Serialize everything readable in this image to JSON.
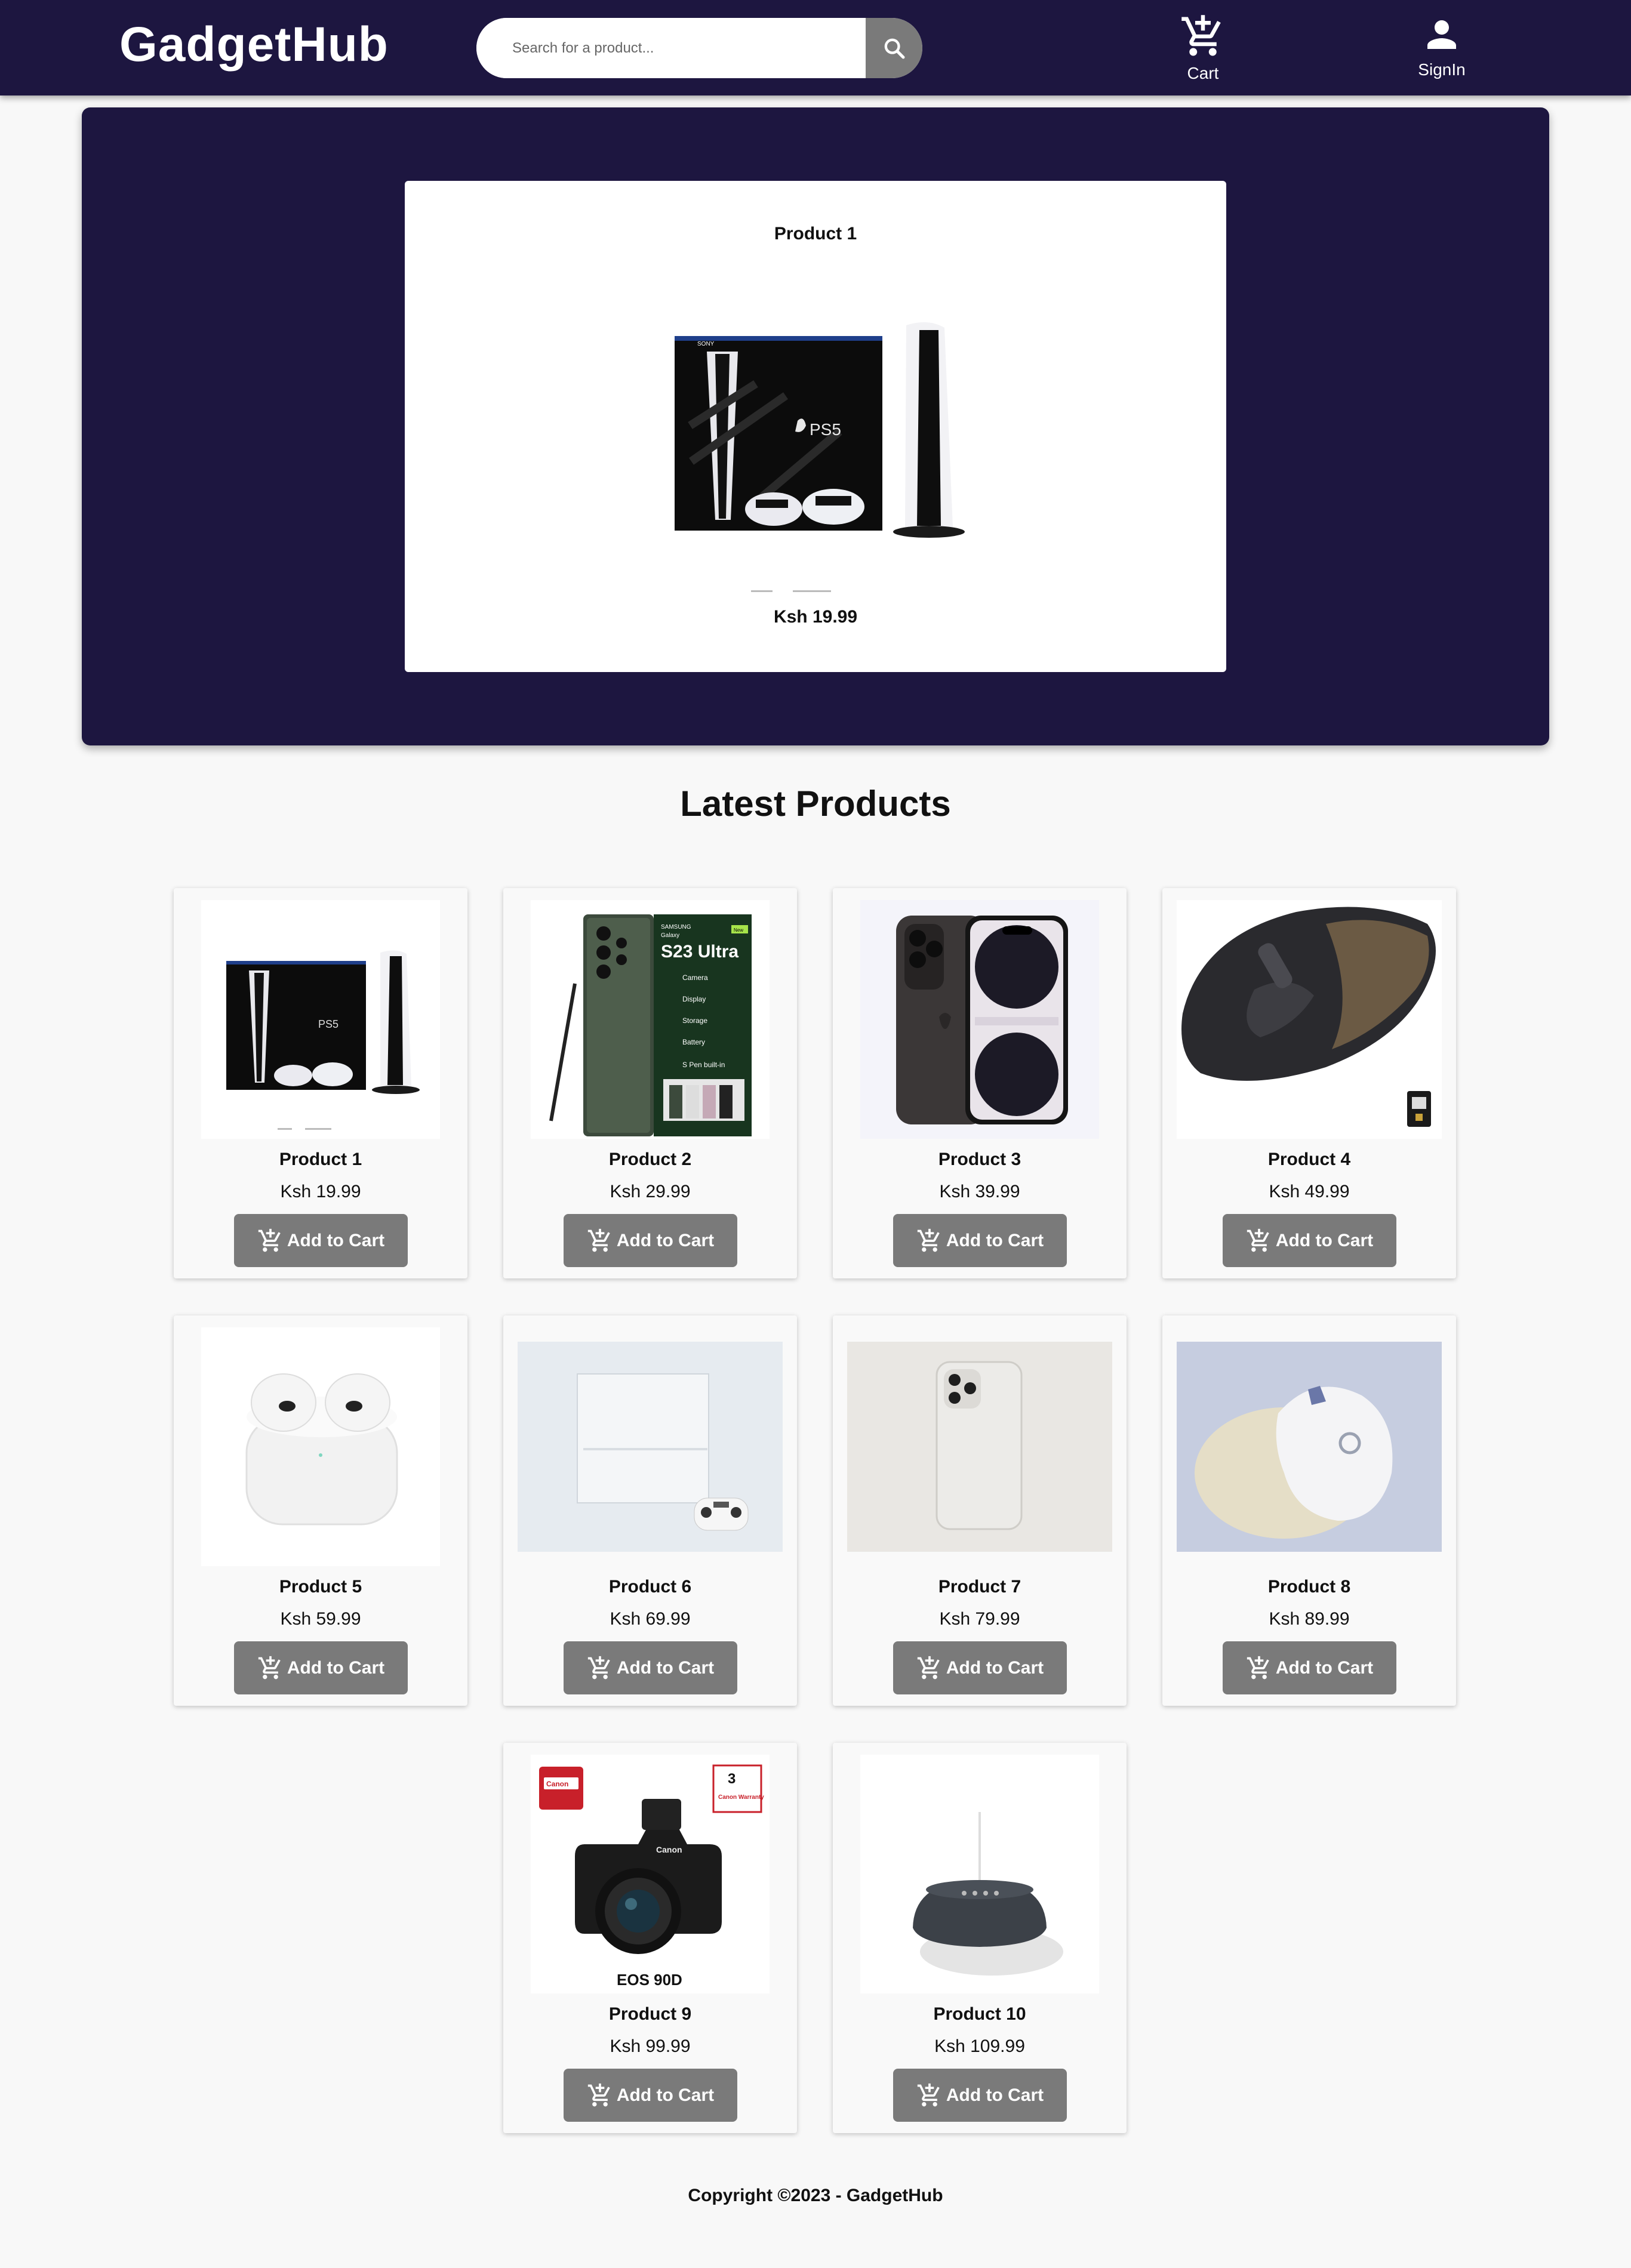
{
  "header": {
    "logo": "GadgetHub",
    "search": {
      "placeholder": "Search for a product...",
      "value": ""
    },
    "cart_label": "Cart",
    "signin_label": "SignIn"
  },
  "hero": {
    "name": "Product 1",
    "price": "Ksh 19.99",
    "image": "ps5-console-image"
  },
  "latest": {
    "title": "Latest Products",
    "add_label": "Add to Cart",
    "products": [
      {
        "name": "Product 1",
        "price": "Ksh 19.99",
        "image": "ps5-console-image"
      },
      {
        "name": "Product 2",
        "price": "Ksh 29.99",
        "image": "samsung-s23-ultra-image"
      },
      {
        "name": "Product 3",
        "price": "Ksh 39.99",
        "image": "iphone-14-pro-image"
      },
      {
        "name": "Product 4",
        "price": "Ksh 49.99",
        "image": "logitech-mx-master-mouse-image"
      },
      {
        "name": "Product 5",
        "price": "Ksh 59.99",
        "image": "airpods-image"
      },
      {
        "name": "Product 6",
        "price": "Ksh 69.99",
        "image": "ps4-console-image"
      },
      {
        "name": "Product 7",
        "price": "Ksh 79.99",
        "image": "iphone-11-pro-image"
      },
      {
        "name": "Product 8",
        "price": "Ksh 89.99",
        "image": "logitech-g-mouse-image"
      },
      {
        "name": "Product 9",
        "price": "Ksh 99.99",
        "image": "canon-eos-90d-image"
      },
      {
        "name": "Product 10",
        "price": "Ksh 109.99",
        "image": "google-nest-mini-image"
      }
    ]
  },
  "footer": {
    "copyright": "Copyright ©2023 - GadgetHub"
  },
  "colors": {
    "header_bg": "#1d1640",
    "button_bg": "#7a7a7a",
    "page_bg": "#f8f8f8"
  },
  "product_art": {
    "ps5_brand": "SONY",
    "ps5_logo": "PS5",
    "s23_brand": "SAMSUNG",
    "s23_galaxy": "Galaxy",
    "s23_model": "S23 Ultra",
    "s23_new": "New",
    "s23_features": [
      "Camera",
      "Display",
      "Storage",
      "Battery",
      "S Pen built-in"
    ],
    "canon_brand": "Canon",
    "canon_model": "EOS 90D",
    "canon_warranty_years": "3",
    "canon_warranty_text": "Canon Warranty"
  }
}
